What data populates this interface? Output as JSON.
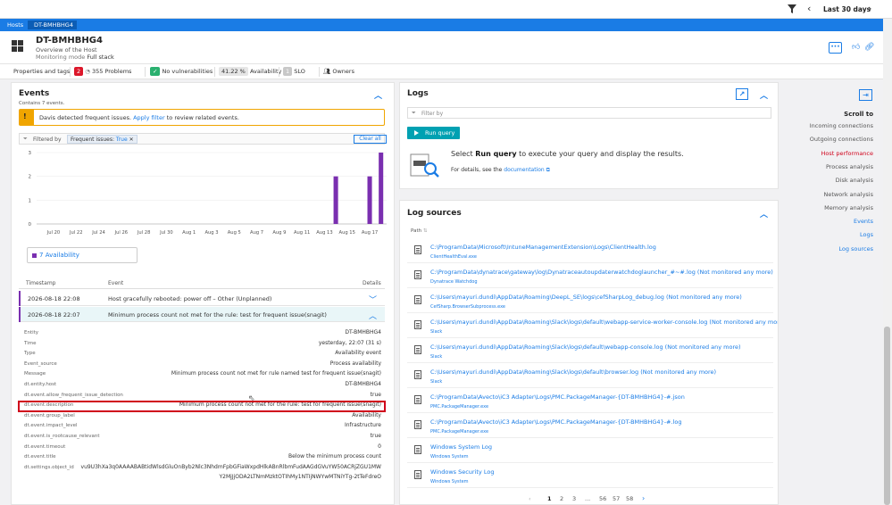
{
  "topbar": {
    "timeframe": "Last 30 days"
  },
  "breadcrumb": {
    "hosts": "Hosts",
    "current": "DT-BMHBHG4"
  },
  "header": {
    "title": "DT-BMHBHG4",
    "subtitle": "Overview of the Host",
    "monitoring_label": "Monitoring mode",
    "monitoring_value": "Full stack",
    "more": "···"
  },
  "tabs": {
    "properties": "Properties and tags",
    "problems_badge": "2",
    "problems_count": "355",
    "problems_label": "Problems",
    "vuln_label": "No vulnerabilities",
    "availability_value": "41.22 %",
    "availability_label": "Availability",
    "slo_badge": "1",
    "slo_label": "SLO",
    "owners_label": "Owners"
  },
  "events": {
    "title": "Events",
    "subtitle": "Contains 7 events.",
    "warning_text": "Davis detected frequent issues.",
    "warning_link": "Apply filter",
    "warning_tail": "to review related events.",
    "filtered_by": "Filtered by",
    "chip_key": "Frequent issues:",
    "chip_value": "True",
    "clear_all": "Clear all",
    "legend_count": "7",
    "legend_label": "Availability",
    "columns": {
      "timestamp": "Timestamp",
      "event": "Event",
      "details": "Details"
    },
    "rows": [
      {
        "time": "2026-08-18 22:08",
        "event": "Host gracefully rebooted: power off – Other (Unplanned)"
      },
      {
        "time": "2026-08-18 22:07",
        "event": "Minimum process count not met for the rule: test for frequent issue(snagit)"
      }
    ],
    "details": [
      {
        "k": "Entity",
        "v": "DT-BMHBHG4"
      },
      {
        "k": "Time",
        "v": "yesterday, 22:07 (31 s)"
      },
      {
        "k": "Type",
        "v": "Availability event"
      },
      {
        "k": "Event_source",
        "v": "Process availability"
      },
      {
        "k": "Message",
        "v": "Minimum process count not met for rule named test for frequent issue(snagit)"
      },
      {
        "k": "dt.entity.host",
        "v": "DT-BMHBHG4"
      },
      {
        "k": "dt.event.allow_frequent_issue_detection",
        "v": "true"
      },
      {
        "k": "dt.event.description",
        "v": "Minimum process count not met for the rule: test for frequent issue(snagit)"
      },
      {
        "k": "dt.event.group_label",
        "v": "Availability"
      },
      {
        "k": "dt.event.impact_level",
        "v": "Infrastructure"
      },
      {
        "k": "dt.event.is_rootcause_relevant",
        "v": "true"
      },
      {
        "k": "dt.event.timeout",
        "v": "0"
      },
      {
        "k": "dt.event.title",
        "v": "Below the minimum process count"
      },
      {
        "k": "dt.settings.object_id",
        "v": "vu9U3hXa3q0AAAABABtidWlsdGluOnByb2Nlc3NhdmFpbGFiaWxpdHlkABnRlbmFudAAGdGVuYW50ACRjZGU1MW"
      },
      {
        "k": "",
        "v": "Y2MjJjODA2LTNmMzktOTIhMy1NTIjNWYwMTNiYTg-2tTeFdreO"
      }
    ]
  },
  "chart_data": {
    "type": "bar",
    "categories": [
      "Jul 20",
      "Jul 22",
      "Jul 24",
      "Jul 26",
      "Jul 28",
      "Jul 30",
      "Aug 1",
      "Aug 3",
      "Aug 5",
      "Aug 7",
      "Aug 9",
      "Aug 11",
      "Aug 13",
      "Aug 15",
      "Aug 17"
    ],
    "series": [
      {
        "name": "Availability",
        "values": [
          0,
          0,
          0,
          0,
          0,
          0,
          0,
          0,
          0,
          0,
          0,
          0,
          0,
          2,
          2,
          3
        ]
      }
    ],
    "bar_days": [
      "Aug 14",
      "Aug 17",
      "Aug 18"
    ],
    "bar_values": [
      2,
      2,
      3
    ],
    "ylim": [
      0,
      3
    ],
    "yticks": [
      "0",
      "1",
      "2",
      "3"
    ],
    "color": "#7a2fb0"
  },
  "logs": {
    "title": "Logs",
    "filter_placeholder": "Filter by",
    "run_query": "Run query",
    "intro_pre": "Select",
    "intro_bold": "Run query",
    "intro_post": "to execute your query and display the results.",
    "details_pre": "For details, see the",
    "details_link": "documentation"
  },
  "log_sources": {
    "title": "Log sources",
    "path_header": "Path",
    "rows": [
      {
        "path": "C:\\ProgramData\\Microsoft\\IntuneManagementExtension\\Logs\\ClientHealth.log",
        "source": "ClientHealthEval.exe"
      },
      {
        "path": "C:\\ProgramData\\dynatrace\\gateway\\log\\Dynatraceautoupdaterwatchdoglauncher_#~#.log (Not monitored any more)",
        "source": "Dynatrace Watchdog"
      },
      {
        "path": "C:\\Users\\mayuri.dundi\\AppData\\Roaming\\DeepL_SE\\logs\\cefSharpLog_debug.log (Not monitored any more)",
        "source": "CefSharp.BrowserSubprocess.exe"
      },
      {
        "path": "C:\\Users\\mayuri.dundi\\AppData\\Roaming\\Slack\\logs\\default\\webapp-service-worker-console.log (Not monitored any more)",
        "source": "Slack"
      },
      {
        "path": "C:\\Users\\mayuri.dundi\\AppData\\Roaming\\Slack\\logs\\default\\webapp-console.log (Not monitored any more)",
        "source": "Slack"
      },
      {
        "path": "C:\\Users\\mayuri.dundi\\AppData\\Roaming\\Slack\\logs\\default\\browser.log (Not monitored any more)",
        "source": "Slack"
      },
      {
        "path": "C:\\ProgramData\\Avecto\\iC3 Adapter\\Logs\\PMC.PackageManager-{DT-BMHBHG4}-#.json",
        "source": "PMC.PackageManager.exe"
      },
      {
        "path": "C:\\ProgramData\\Avecto\\iC3 Adapter\\Logs\\PMC.PackageManager-{DT-BMHBHG4}-#.log",
        "source": "PMC.PackageManager.exe"
      },
      {
        "path": "Windows System Log",
        "source": "Windows System"
      },
      {
        "path": "Windows Security Log",
        "source": "Windows System"
      }
    ],
    "pages": [
      "1",
      "2",
      "3",
      "...",
      "56",
      "57",
      "58"
    ]
  },
  "scroll_to": {
    "title": "Scroll to",
    "items": [
      {
        "label": "Incoming connections",
        "state": "normal"
      },
      {
        "label": "Outgoing connections",
        "state": "normal"
      },
      {
        "label": "Host performance",
        "state": "active"
      },
      {
        "label": "Process analysis",
        "state": "normal"
      },
      {
        "label": "Disk analysis",
        "state": "normal"
      },
      {
        "label": "Network analysis",
        "state": "normal"
      },
      {
        "label": "Memory analysis",
        "state": "normal"
      },
      {
        "label": "Events",
        "state": "link"
      },
      {
        "label": "Logs",
        "state": "link"
      },
      {
        "label": "Log sources",
        "state": "link"
      }
    ]
  }
}
